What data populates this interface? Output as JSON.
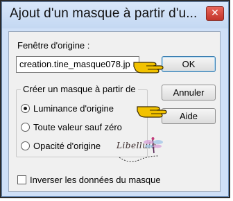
{
  "window": {
    "title": "Ajout d'un masque à partir d'u...",
    "close_symbol": "✕"
  },
  "source": {
    "label": "Fenêtre d'origine :",
    "value": "creation.tine_masque078.jp"
  },
  "buttons": {
    "ok": "OK",
    "cancel": "Annuler",
    "help": "Aide"
  },
  "create_from": {
    "legend": "Créer un masque à partir de",
    "options": [
      {
        "label": "Luminance d'origine",
        "selected": true
      },
      {
        "label": "Toute valeur sauf zéro",
        "selected": false
      },
      {
        "label": "Opacité d'origine",
        "selected": false
      }
    ]
  },
  "invert": {
    "label": "Inverser les données du masque",
    "checked": false
  },
  "watermark": {
    "text": "Libellule",
    "icon": "dragonfly-icon"
  },
  "pointer_icon": "pointing-hand-icon",
  "colors": {
    "title_bg": "#cfe0f7",
    "close_button": "#c9392e",
    "hand": "#f2c200"
  }
}
